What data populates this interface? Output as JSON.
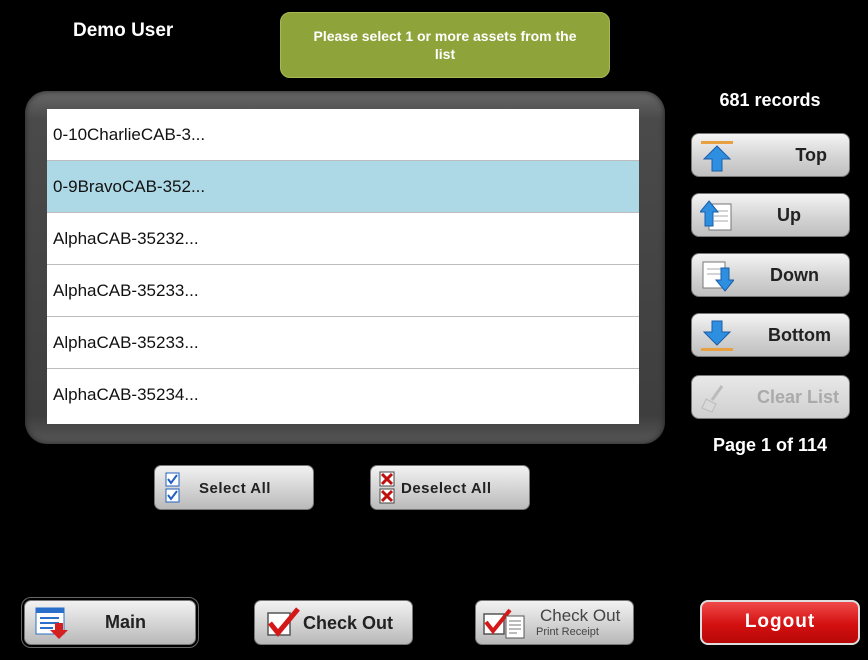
{
  "header": {
    "user_name": "Demo User",
    "prompt": "Please select 1 or more assets from the list"
  },
  "list": {
    "items": [
      {
        "label": "0-10CharlieCAB-3...",
        "selected": false
      },
      {
        "label": "0-9BravoCAB-352...",
        "selected": true
      },
      {
        "label": "AlphaCAB-35232...",
        "selected": false
      },
      {
        "label": "AlphaCAB-35233...",
        "selected": false
      },
      {
        "label": "AlphaCAB-35233...",
        "selected": false
      },
      {
        "label": "AlphaCAB-35234...",
        "selected": false
      }
    ]
  },
  "pager": {
    "records": "681 records",
    "top_label": "Top",
    "up_label": "Up",
    "down_label": "Down",
    "bottom_label": "Bottom",
    "clear_label": "Clear List",
    "page_info": "Page 1 of 114"
  },
  "selection": {
    "select_all_label": "Select All",
    "deselect_all_label": "Deselect All"
  },
  "footer": {
    "main_label": "Main",
    "check_out_label": "Check Out",
    "check_out_print_label": "Check Out",
    "check_out_print_sub": "Print Receipt",
    "logout_label": "Logout"
  },
  "colors": {
    "accent_green": "#8fa33b",
    "selected_row": "#add9e6",
    "logout_red": "#d41010",
    "arrow_blue": "#2e8fe0"
  }
}
